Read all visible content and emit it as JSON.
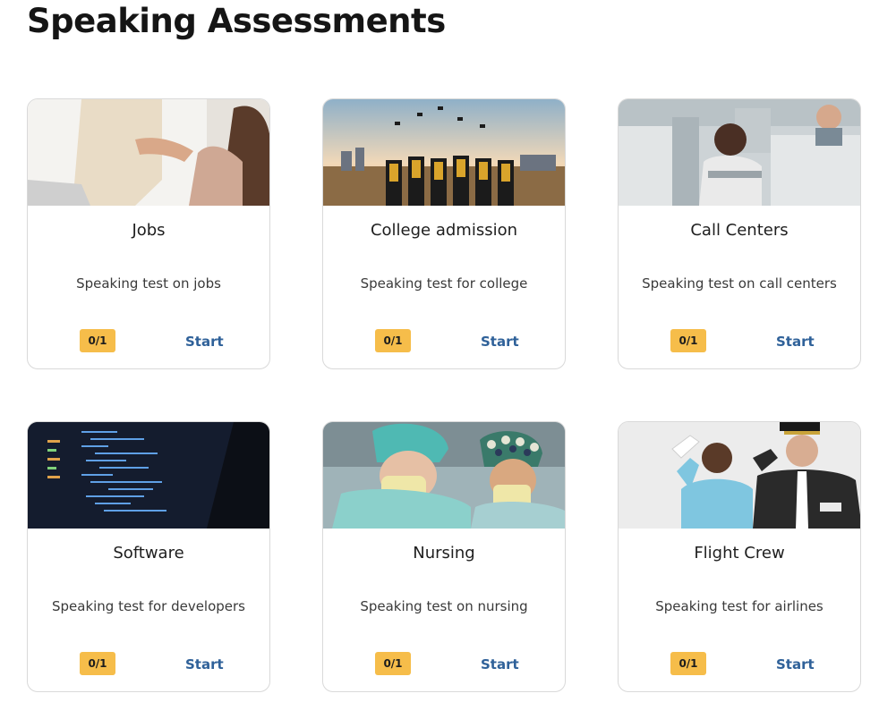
{
  "page": {
    "title": "Speaking Assessments"
  },
  "colors": {
    "badge": "#f6bd4a",
    "link": "#2f6199"
  },
  "cards": [
    {
      "title": "Jobs",
      "description": "Speaking test on jobs",
      "progress": "0/1",
      "action": "Start",
      "image": "handshake-photo"
    },
    {
      "title": "College admission",
      "description": "Speaking test for college",
      "progress": "0/1",
      "action": "Start",
      "image": "graduation-photo"
    },
    {
      "title": "Call Centers",
      "description": "Speaking test on call centers",
      "progress": "0/1",
      "action": "Start",
      "image": "call-center-photo"
    },
    {
      "title": "Software",
      "description": "Speaking test for developers",
      "progress": "0/1",
      "action": "Start",
      "image": "code-screen-photo"
    },
    {
      "title": "Nursing",
      "description": "Speaking test on nursing",
      "progress": "0/1",
      "action": "Start",
      "image": "nurses-photo"
    },
    {
      "title": "Flight Crew",
      "description": "Speaking test for airlines",
      "progress": "0/1",
      "action": "Start",
      "image": "flight-crew-photo"
    }
  ]
}
